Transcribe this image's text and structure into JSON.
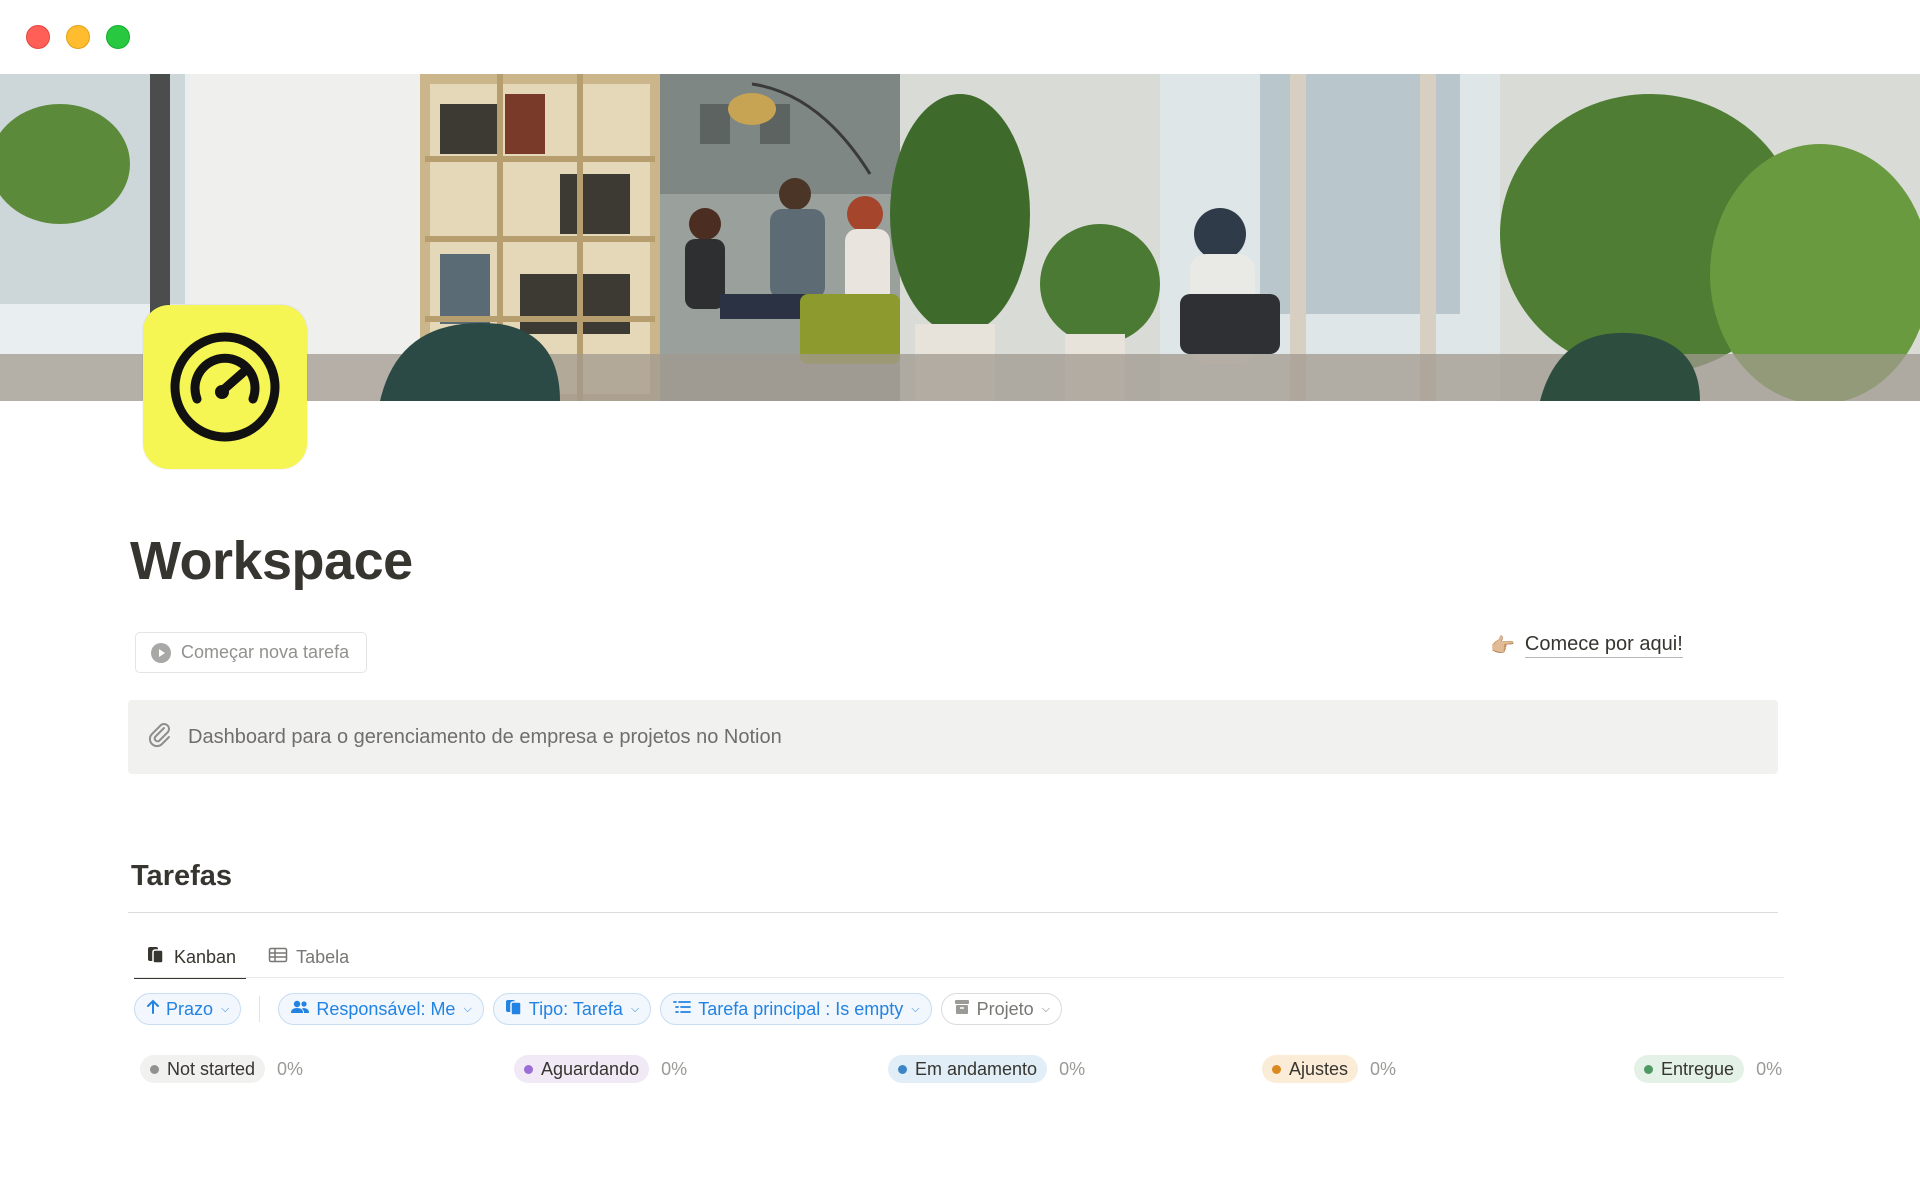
{
  "page": {
    "title": "Workspace",
    "new_task_button": "Começar nova tarefa",
    "start_here_emoji": "👉🏼",
    "start_here_label": "Comece por aqui!",
    "callout_icon": "paperclip-icon",
    "callout_text": "Dashboard para o gerenciamento de empresa e projetos no Notion",
    "icon": "speedometer-icon",
    "icon_bg": "#f5f553"
  },
  "section": {
    "title": "Tarefas"
  },
  "tabs": [
    {
      "label": "Kanban",
      "icon": "kanban-icon",
      "active": true
    },
    {
      "label": "Tabela",
      "icon": "table-icon",
      "active": false
    }
  ],
  "filters": {
    "sort": {
      "label": "Prazo",
      "icon": "arrow-up-icon"
    },
    "responsavel": {
      "label": "Responsável: Me",
      "icon": "people-icon"
    },
    "tipo": {
      "label": "Tipo: Tarefa",
      "icon": "cards-icon"
    },
    "tarefa_principal": {
      "label": "Tarefa principal : Is empty",
      "icon": "list-icon"
    },
    "projeto": {
      "label": "Projeto",
      "icon": "archive-icon"
    }
  },
  "columns": [
    {
      "label": "Not started",
      "percent": "0%",
      "bg": "#f1f1ef",
      "dot": "#91918e"
    },
    {
      "label": "Aguardando",
      "percent": "0%",
      "bg": "#f1e9f6",
      "dot": "#9a6dd7"
    },
    {
      "label": "Em andamento",
      "percent": "0%",
      "bg": "#e1eef8",
      "dot": "#3c86c5"
    },
    {
      "label": "Ajustes",
      "percent": "0%",
      "bg": "#fbecd7",
      "dot": "#d9891f"
    },
    {
      "label": "Entregue",
      "percent": "0%",
      "bg": "#e3f1e6",
      "dot": "#4f9a64"
    }
  ]
}
